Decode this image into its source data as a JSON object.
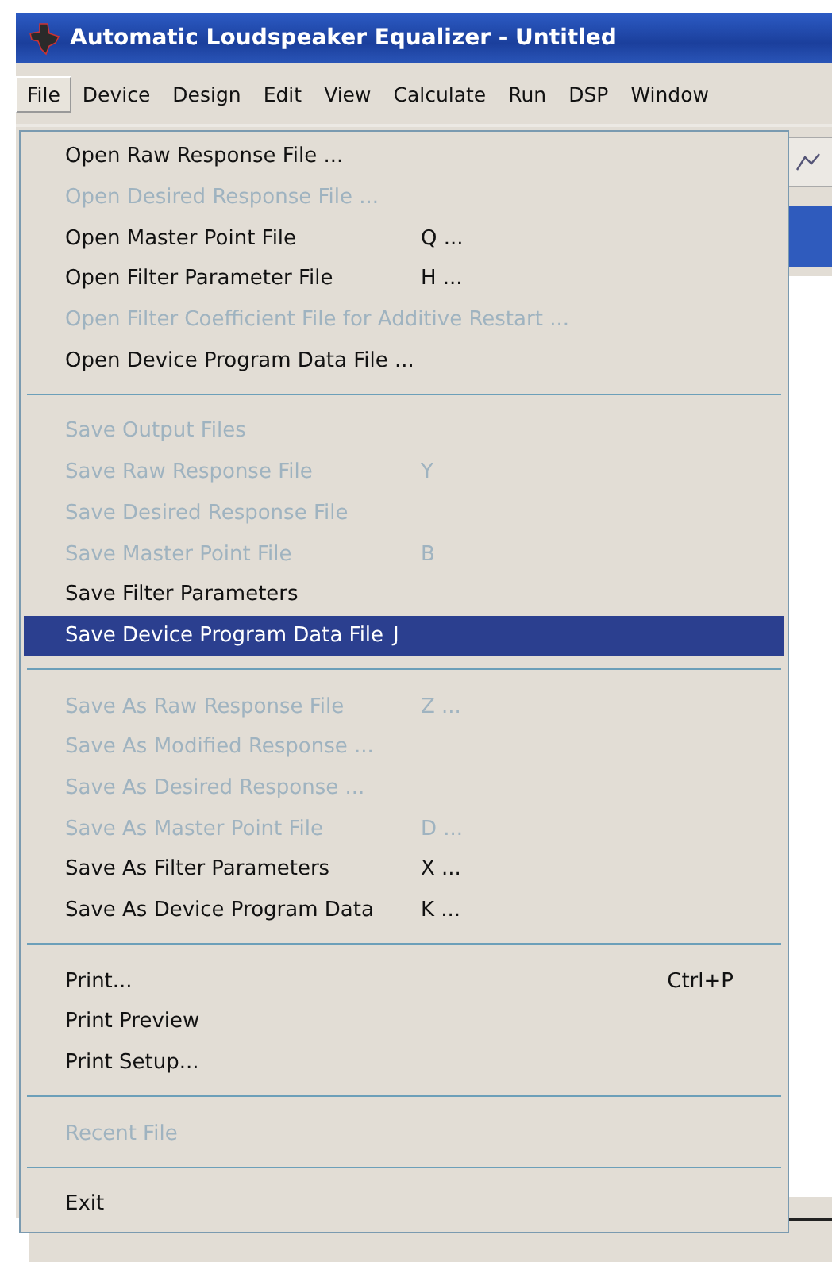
{
  "window": {
    "title": "Automatic Loudspeaker Equalizer - Untitled"
  },
  "menu_bar": [
    {
      "label": "File",
      "selected": true
    },
    {
      "label": "Device",
      "selected": false
    },
    {
      "label": "Design",
      "selected": false
    },
    {
      "label": "Edit",
      "selected": false
    },
    {
      "label": "View",
      "selected": false
    },
    {
      "label": "Calculate",
      "selected": false
    },
    {
      "label": "Run",
      "selected": false
    },
    {
      "label": "DSP",
      "selected": false
    },
    {
      "label": "Window",
      "selected": false
    }
  ],
  "file_menu": {
    "groups": [
      {
        "items": [
          {
            "label": "Open Raw Response File ...",
            "disabled": false,
            "selected": false
          },
          {
            "label": "Open Desired Response File ...",
            "disabled": true,
            "selected": false
          },
          {
            "label": "Open Master Point File",
            "shortcut": "Q ...",
            "disabled": false,
            "selected": false
          },
          {
            "label": "Open Filter Parameter File",
            "shortcut": "H ...",
            "disabled": false,
            "selected": false
          },
          {
            "label": "Open Filter Coefficient File for Additive Restart ...",
            "disabled": true,
            "selected": false
          },
          {
            "label": "Open Device Program Data File ...",
            "disabled": false,
            "selected": false
          }
        ]
      },
      {
        "items": [
          {
            "label": "Save Output Files",
            "disabled": true,
            "selected": false
          },
          {
            "label": "Save Raw Response File",
            "shortcut": "Y",
            "disabled": true,
            "selected": false
          },
          {
            "label": "Save Desired Response File",
            "disabled": true,
            "selected": false
          },
          {
            "label": "Save Master Point File",
            "shortcut": "B",
            "disabled": true,
            "selected": false
          },
          {
            "label": "Save Filter Parameters",
            "disabled": false,
            "selected": false
          },
          {
            "label": "Save Device Program Data File",
            "shortcut": "J",
            "disabled": false,
            "selected": true
          }
        ]
      },
      {
        "items": [
          {
            "label": "Save As Raw Response File",
            "shortcut": "Z ...",
            "disabled": true,
            "selected": false
          },
          {
            "label": "Save As Modified Response ...",
            "disabled": true,
            "selected": false
          },
          {
            "label": "Save As  Desired Response ...",
            "disabled": true,
            "selected": false
          },
          {
            "label": "Save As Master Point File",
            "shortcut": "D ...",
            "disabled": true,
            "selected": false
          },
          {
            "label": "Save As Filter Parameters",
            "shortcut": "X ...",
            "disabled": false,
            "selected": false
          },
          {
            "label": "Save As Device Program Data",
            "shortcut": "K ...",
            "disabled": false,
            "selected": false
          }
        ]
      },
      {
        "items": [
          {
            "label": "Print...",
            "accelerator": "Ctrl+P",
            "disabled": false,
            "selected": false
          },
          {
            "label": "Print Preview",
            "disabled": false,
            "selected": false
          },
          {
            "label": "Print Setup...",
            "disabled": false,
            "selected": false
          }
        ]
      },
      {
        "items": [
          {
            "label": "Recent File",
            "disabled": true,
            "selected": false
          }
        ]
      },
      {
        "items": [
          {
            "label": "Exit",
            "disabled": false,
            "selected": false
          }
        ]
      }
    ]
  }
}
